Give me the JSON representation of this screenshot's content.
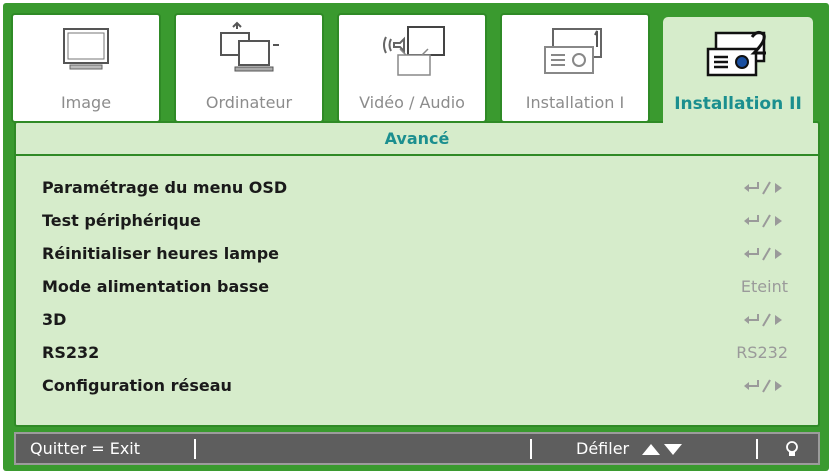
{
  "tabs": [
    {
      "label": "Image",
      "icon": "monitor-icon",
      "active": false
    },
    {
      "label": "Ordinateur",
      "icon": "computer-icon",
      "active": false
    },
    {
      "label": "Vidéo / Audio",
      "icon": "tv-speaker-icon",
      "active": false
    },
    {
      "label": "Installation I",
      "icon": "projector-1-icon",
      "active": false
    },
    {
      "label": "Installation II",
      "icon": "projector-2-icon",
      "active": true
    }
  ],
  "section_title": "Avancé",
  "menu_items": [
    {
      "label": "Paramétrage du menu OSD",
      "value": "",
      "icon": "enter-arrow-icon"
    },
    {
      "label": "Test périphérique",
      "value": "",
      "icon": "enter-arrow-icon"
    },
    {
      "label": "Réinitialiser heures lampe",
      "value": "",
      "icon": "enter-arrow-icon"
    },
    {
      "label": "Mode alimentation basse",
      "value": "Eteint",
      "icon": ""
    },
    {
      "label": "3D",
      "value": "",
      "icon": "enter-arrow-icon"
    },
    {
      "label": "RS232",
      "value": "RS232",
      "icon": ""
    },
    {
      "label": "Configuration réseau",
      "value": "",
      "icon": "enter-arrow-icon"
    }
  ],
  "footer": {
    "exit_label": "Quitter = Exit",
    "scroll_label": "Défiler",
    "scroll_icon": "up-down-triangles-icon",
    "lamp_icon": "lamp-icon"
  },
  "colors": {
    "frame": "#3a9a2f",
    "panel": "#d6eccb",
    "accent_text": "#1b8f8f",
    "footer": "#5e5e5e"
  }
}
